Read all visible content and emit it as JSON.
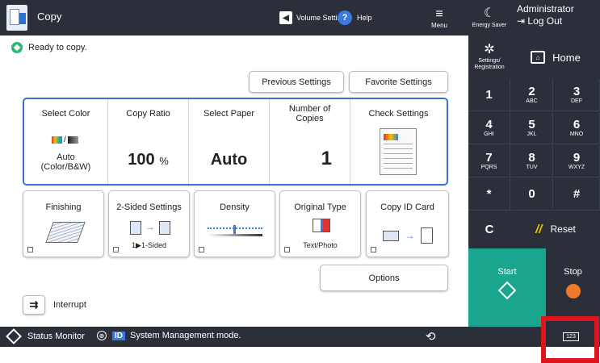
{
  "header": {
    "app_title": "Copy",
    "volume_label": "Volume Settings",
    "help_label": "Help",
    "menu_label": "Menu"
  },
  "right_panel": {
    "energy_saver_label": "Energy Saver",
    "user_name": "Administrator",
    "logout_label": "Log Out",
    "settings_label_line1": "Settings/",
    "settings_label_line2": "Registration",
    "home_label": "Home",
    "keys": [
      {
        "num": "1",
        "sub": ""
      },
      {
        "num": "2",
        "sub": "ABC"
      },
      {
        "num": "3",
        "sub": "DEF"
      },
      {
        "num": "4",
        "sub": "GHI"
      },
      {
        "num": "5",
        "sub": "JKL"
      },
      {
        "num": "6",
        "sub": "MNO"
      },
      {
        "num": "7",
        "sub": "PQRS"
      },
      {
        "num": "8",
        "sub": "TUV"
      },
      {
        "num": "9",
        "sub": "WXYZ"
      },
      {
        "num": "*",
        "sub": ""
      },
      {
        "num": "0",
        "sub": ""
      },
      {
        "num": "#",
        "sub": ""
      }
    ],
    "clear_label": "C",
    "reset_label": "Reset",
    "start_label": "Start",
    "stop_label": "Stop"
  },
  "status": {
    "message": "Ready to copy."
  },
  "actions": {
    "previous_settings": "Previous Settings",
    "favorite_settings": "Favorite Settings",
    "options": "Options",
    "interrupt": "Interrupt"
  },
  "main_settings": {
    "select_color": {
      "title": "Select Color",
      "value_line1": "Auto",
      "value_line2": "(Color/B&W)"
    },
    "copy_ratio": {
      "title": "Copy Ratio",
      "value": "100",
      "unit": "%"
    },
    "select_paper": {
      "title": "Select Paper",
      "value": "Auto"
    },
    "copies": {
      "title_line1": "Number of",
      "title_line2": "Copies",
      "value": "1"
    },
    "check_settings": {
      "title": "Check Settings"
    }
  },
  "functions": {
    "finishing": {
      "title": "Finishing"
    },
    "two_sided": {
      "title": "2-Sided Settings",
      "value": "1▶1-Sided"
    },
    "density": {
      "title": "Density"
    },
    "original_type": {
      "title": "Original Type",
      "value": "Text/Photo"
    },
    "copy_id_card": {
      "title": "Copy ID Card"
    }
  },
  "bottom_bar": {
    "status_monitor": "Status Monitor",
    "id_badge": "ID",
    "mode_text": "System Management mode."
  },
  "colors": {
    "dark_bar": "#2b2f3a",
    "accent_blue": "#3b71d0",
    "start_green": "#1aa58f",
    "stop_orange": "#f07a2a",
    "highlight_red": "#e0141c"
  }
}
